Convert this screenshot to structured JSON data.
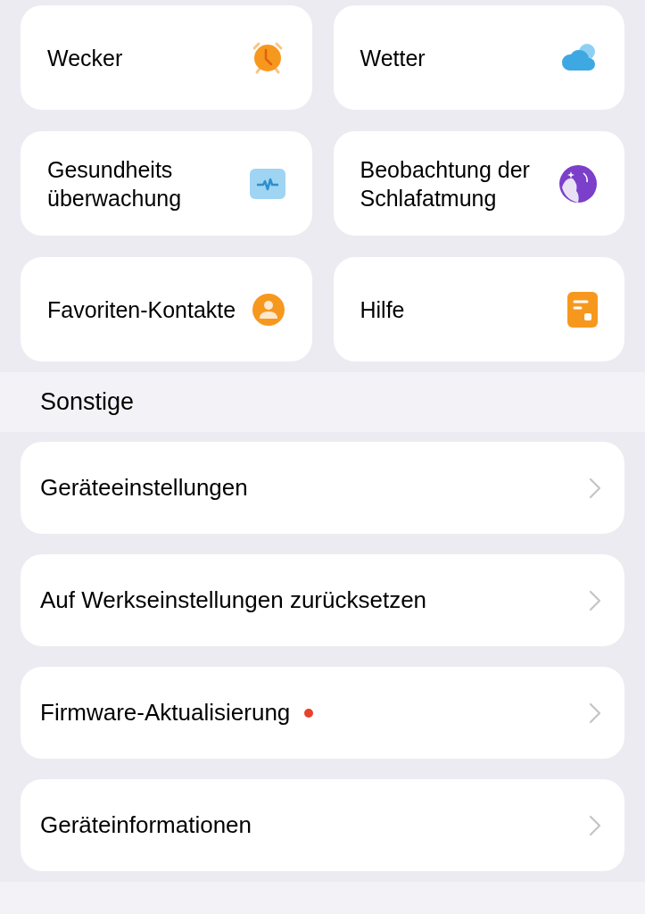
{
  "tiles": [
    {
      "label": "Wecker",
      "kind": "alarm"
    },
    {
      "label": "Wetter",
      "kind": "weather"
    },
    {
      "label": "Gesundheits überwachung",
      "kind": "health"
    },
    {
      "label": "Beobachtung der Schlafatmung",
      "kind": "sleep"
    },
    {
      "label": "Favoriten-Kontakte",
      "kind": "contact"
    },
    {
      "label": "Hilfe",
      "kind": "help"
    }
  ],
  "section": {
    "title": "Sonstige"
  },
  "items": [
    {
      "label": "Geräteeinstellungen",
      "badge": false
    },
    {
      "label": "Auf Werkseinstellungen zurücksetzen",
      "badge": false
    },
    {
      "label": "Firmware-Aktualisierung",
      "badge": true
    },
    {
      "label": "Geräteinformationen",
      "badge": false
    }
  ]
}
